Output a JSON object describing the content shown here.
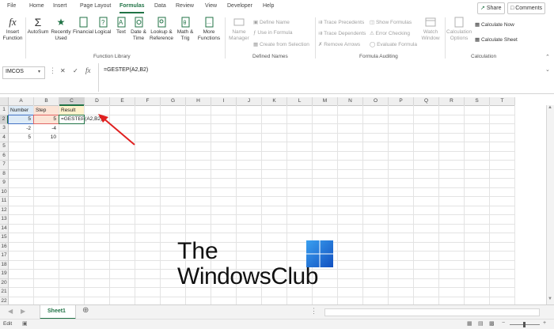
{
  "tabs": [
    "File",
    "Home",
    "Insert",
    "Page Layout",
    "Formulas",
    "Data",
    "Review",
    "View",
    "Developer",
    "Help"
  ],
  "active_tab": "Formulas",
  "share_label": "Share",
  "comments_label": "Comments",
  "ribbon": {
    "insert_function": [
      "Insert",
      "Function"
    ],
    "autosum": "AutoSum",
    "recently_used": [
      "Recently",
      "Used"
    ],
    "financial": "Financial",
    "logical": "Logical",
    "text": "Text",
    "date_time": [
      "Date &",
      "Time"
    ],
    "lookup_reference": [
      "Lookup &",
      "Reference"
    ],
    "math_trig": [
      "Math &",
      "Trig"
    ],
    "more_functions": [
      "More",
      "Functions"
    ],
    "function_library_label": "Function Library",
    "name_manager": [
      "Name",
      "Manager"
    ],
    "define_name": "Define Name",
    "use_in_formula": "Use in Formula",
    "create_from_selection": "Create from Selection",
    "defined_names_label": "Defined Names",
    "trace_precedents": "Trace Precedents",
    "trace_dependents": "Trace Dependents",
    "remove_arrows": "Remove Arrows",
    "show_formulas": "Show Formulas",
    "error_checking": "Error Checking",
    "evaluate_formula": "Evaluate Formula",
    "watch_window": [
      "Watch",
      "Window"
    ],
    "formula_auditing_label": "Formula Auditing",
    "calculation_options": [
      "Calculation",
      "Options"
    ],
    "calculate_now": "Calculate Now",
    "calculate_sheet": "Calculate Sheet",
    "calculation_label": "Calculation"
  },
  "name_box": "IMCOS",
  "formula": "=GESTEP(A2,B2)",
  "columns": [
    "A",
    "B",
    "C",
    "D",
    "E",
    "F",
    "G",
    "H",
    "I",
    "J",
    "K",
    "L",
    "M",
    "N",
    "O",
    "P",
    "Q",
    "R",
    "S",
    "T"
  ],
  "rows": [
    "1",
    "2",
    "3",
    "4",
    "5",
    "6",
    "7",
    "8",
    "9",
    "10",
    "11",
    "12",
    "13",
    "14",
    "15",
    "16",
    "17",
    "18",
    "19",
    "20",
    "21",
    "22"
  ],
  "cells": {
    "A1": "Number",
    "B1": "Step",
    "C1": "Result",
    "A2": "5",
    "B2": "5",
    "C2": "=GESTEP(A2,B2)",
    "A3": "-2",
    "B3": "-4",
    "A4": "5",
    "B4": "10"
  },
  "watermark": [
    "The",
    "WindowsClub"
  ],
  "sheet_tab": "Sheet1",
  "status_left": "Edit",
  "colors": {
    "accent": "#217346",
    "c1_fill": "#fff2cc",
    "arrow": "#e02020"
  }
}
